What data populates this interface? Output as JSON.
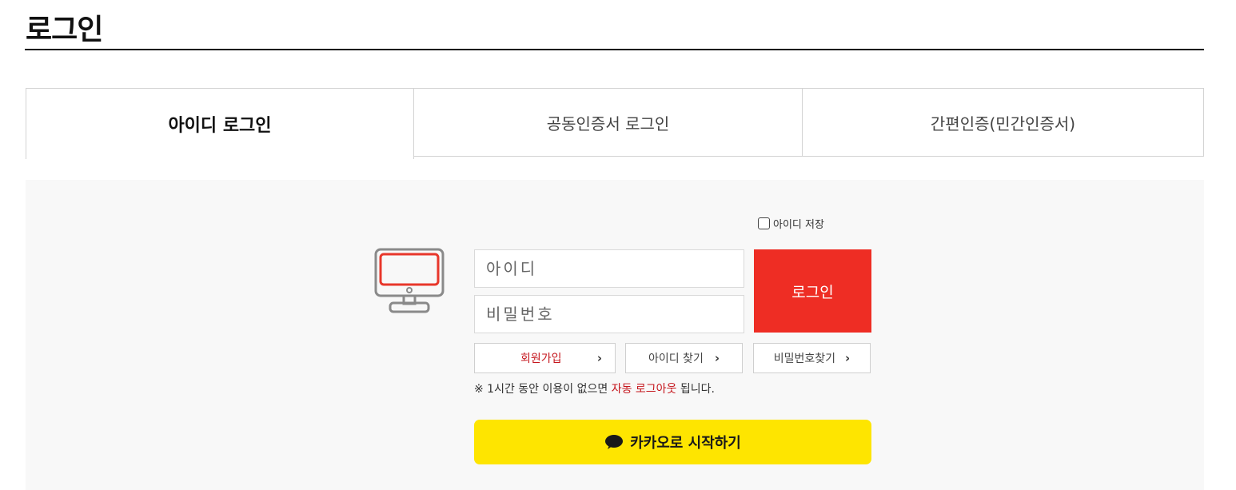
{
  "page": {
    "title": "로그인"
  },
  "tabs": [
    {
      "label": "아이디 로그인",
      "active": true
    },
    {
      "label": "공동인증서 로그인",
      "active": false
    },
    {
      "label": "간편인증(민간인증서)",
      "active": false
    }
  ],
  "form": {
    "save_id_label": "아이디 저장",
    "save_id_checked": false,
    "id_placeholder": "아이디",
    "id_value": "",
    "pw_placeholder": "비밀번호",
    "pw_value": "",
    "login_label": "로그인"
  },
  "links": {
    "signup": "회원가입",
    "find_id": "아이디 찾기",
    "find_pw": "비밀번호찾기"
  },
  "notice": {
    "prefix": "※ 1시간 동안 이용이 없으면 ",
    "highlight": "자동 로그아웃",
    "suffix": " 됩니다."
  },
  "kakao": {
    "label": "카카오로 시작하기"
  },
  "icons": {
    "monitor": "monitor-icon",
    "chevron": "chevron-right-icon",
    "kakao": "kakao-bubble-icon",
    "checkbox": "checkbox-icon"
  },
  "colors": {
    "accent_red": "#ee2d24",
    "highlight_red": "#c5161d",
    "kakao_yellow": "#fee500",
    "panel_bg": "#f8f8f8"
  }
}
